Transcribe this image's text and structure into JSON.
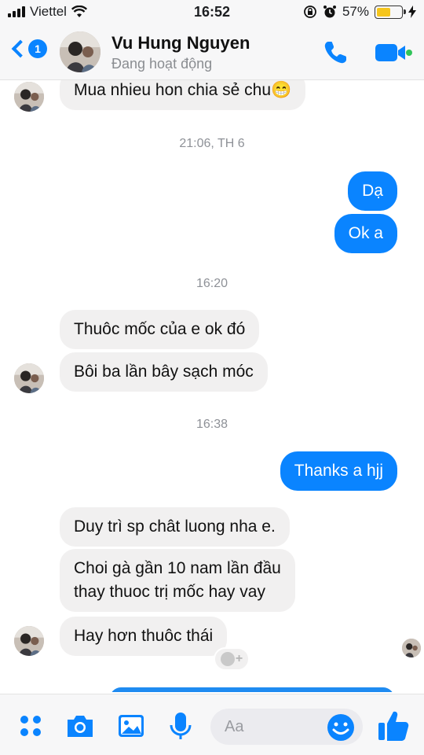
{
  "status_bar": {
    "carrier": "Viettel",
    "time": "16:52",
    "battery_percent": "57%",
    "battery_level": 0.57
  },
  "header": {
    "back_badge_count": "1",
    "contact_name": "Vu Hung Nguyen",
    "contact_status": "Đang hoạt động"
  },
  "thread": {
    "messages": [
      {
        "sender": "contact",
        "text": "Mua nhieu hon chia sẻ chu😁"
      },
      {
        "timestamp": "21:06, TH 6"
      },
      {
        "sender": "me",
        "text": "Dạ"
      },
      {
        "sender": "me",
        "text": "Ok a"
      },
      {
        "timestamp": "16:20"
      },
      {
        "sender": "contact",
        "text": "Thuôc mốc của e ok đó"
      },
      {
        "sender": "contact",
        "text": "Bôi ba lần bây sạch móc"
      },
      {
        "timestamp": "16:38"
      },
      {
        "sender": "me",
        "text": "Thanks a hjj"
      },
      {
        "sender": "contact",
        "text": "Duy trì sp chât luong nha e."
      },
      {
        "sender": "contact",
        "lines": [
          "Choi gà gần 10 nam lần đầu",
          "thay thuoc trị mốc hay vay"
        ]
      },
      {
        "sender": "contact",
        "text": "Hay hơn thuôc thái"
      }
    ]
  },
  "composer": {
    "placeholder": "Aa"
  },
  "colors": {
    "accent": "#0a84ff",
    "incoming_bubble": "#f1f0f0",
    "outgoing_bubble": "#0a84ff",
    "online_dot": "#31c45a",
    "battery": "#f5c51c"
  },
  "icons": [
    "back-chevron-icon",
    "phone-icon",
    "video-camera-icon",
    "menu-grid-icon",
    "camera-icon",
    "photo-icon",
    "microphone-icon",
    "emoji-icon",
    "thumbs-up-icon",
    "add-reaction-icon"
  ]
}
